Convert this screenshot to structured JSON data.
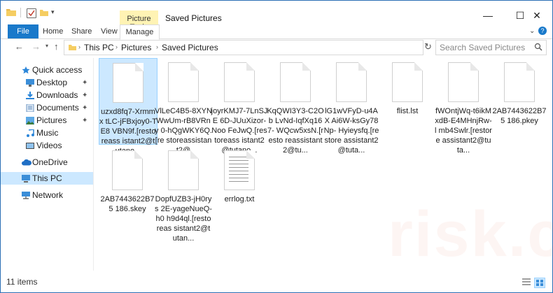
{
  "window": {
    "title": "Saved Pictures",
    "context_tab": "Picture Tools",
    "controls": {
      "minimize": "—",
      "maximize": "☐",
      "close": "✕"
    }
  },
  "ribbon": {
    "tabs": [
      "File",
      "Home",
      "Share",
      "View",
      "Manage"
    ]
  },
  "address": {
    "crumbs": [
      "This PC",
      "Pictures",
      "Saved Pictures"
    ],
    "search_placeholder": "Search Saved Pictures"
  },
  "sidebar": {
    "items": [
      {
        "label": "Quick access",
        "icon": "star-icon"
      },
      {
        "label": "Desktop",
        "icon": "desktop-icon"
      },
      {
        "label": "Downloads",
        "icon": "downloads-icon"
      },
      {
        "label": "Documents",
        "icon": "documents-icon"
      },
      {
        "label": "Pictures",
        "icon": "pictures-icon"
      },
      {
        "label": "Music",
        "icon": "music-icon"
      },
      {
        "label": "Videos",
        "icon": "videos-icon"
      },
      {
        "label": "OneDrive",
        "icon": "cloud-icon"
      },
      {
        "label": "This PC",
        "icon": "computer-icon"
      },
      {
        "label": "Network",
        "icon": "network-icon"
      }
    ]
  },
  "files": [
    {
      "name": "uzxd8fq7-Xrmmx tLC-jFBxjoy0-TE8 VBN9f.[restoreass istant2@tutano..."
    },
    {
      "name": "VlLeC4B5-8XYN WwUm-rB8VRny 0-hQgWKY6Q.[re storeassistant2@"
    },
    {
      "name": "joyrKMJ7-7LnSJE 6D-JUuXizor-Noo FeJwQ.[restoreass istant2@tutano..."
    },
    {
      "name": "KqQWI3Y3-C2Ob LvNd-IqfXq167- WQcw5xsN.[resto reassistant2@tu..."
    },
    {
      "name": "lG1wVFyD-u4AX Ai6W-ksGy78Np- Hyieysfq.[restore assistant2@tuta..."
    },
    {
      "name": "flist.lst"
    },
    {
      "name": "fWOntjWq-t6ikM xdB-E4MHnjRw-l mb4Swlr.[restore assistant2@tuta..."
    },
    {
      "name": "2AB7443622B75 186.pkey"
    },
    {
      "name": "2AB7443622B75 186.skey"
    },
    {
      "name": "DopfUZB3-jH0rys 2E-yageNueQ-h0 h9d4ql.[restoreas sistant2@tutan..."
    },
    {
      "name": "errlog.txt"
    }
  ],
  "status": {
    "count": "11 items"
  },
  "watermark": "risk.com"
}
